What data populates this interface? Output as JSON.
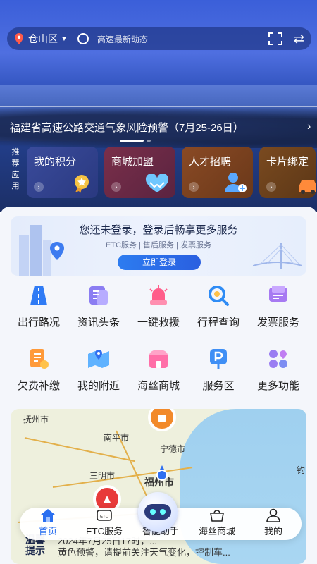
{
  "header": {
    "location": "仓山区",
    "news": "高速最新动态",
    "banner": "福建省高速公路交通气象风险预警（7月25-26日）"
  },
  "recommended": {
    "label": [
      "推",
      "荐",
      "应",
      "用"
    ],
    "cards": [
      {
        "label": "我的积分"
      },
      {
        "label": "商城加盟"
      },
      {
        "label": "人才招聘"
      },
      {
        "label": "卡片绑定"
      }
    ]
  },
  "login": {
    "title": "您还未登录，登录后畅享更多服务",
    "subtitle": "ETC服务 | 售后服务 | 发票服务",
    "button": "立即登录"
  },
  "services": {
    "row1": [
      {
        "label": "出行路况",
        "icon": "road-icon"
      },
      {
        "label": "资讯头条",
        "icon": "news-icon"
      },
      {
        "label": "一键救援",
        "icon": "siren-icon"
      },
      {
        "label": "行程查询",
        "icon": "trip-search-icon"
      },
      {
        "label": "发票服务",
        "icon": "invoice-icon"
      }
    ],
    "row2": [
      {
        "label": "欠费补缴",
        "icon": "payment-icon"
      },
      {
        "label": "我的附近",
        "icon": "nearby-map-icon"
      },
      {
        "label": "海丝商城",
        "icon": "shop-icon"
      },
      {
        "label": "服务区",
        "icon": "parking-icon"
      },
      {
        "label": "更多功能",
        "icon": "more-grid-icon"
      }
    ]
  },
  "map": {
    "labels": [
      "抚州市",
      "南平市",
      "宁德市",
      "三明市",
      "福州市",
      "钓"
    ]
  },
  "notice": {
    "tag": "温馨提示",
    "line1": "2024年7月25日17时，...",
    "line2": "黄色预警，请提前关注天气变化，控制车..."
  },
  "nav": {
    "items": [
      {
        "label": "首页"
      },
      {
        "label": "ETC服务"
      },
      {
        "label": "智能助手"
      },
      {
        "label": "海丝商城"
      },
      {
        "label": "我的"
      }
    ]
  },
  "colors": {
    "accent": "#2a6ff0",
    "hero": "#2c4fb8"
  }
}
